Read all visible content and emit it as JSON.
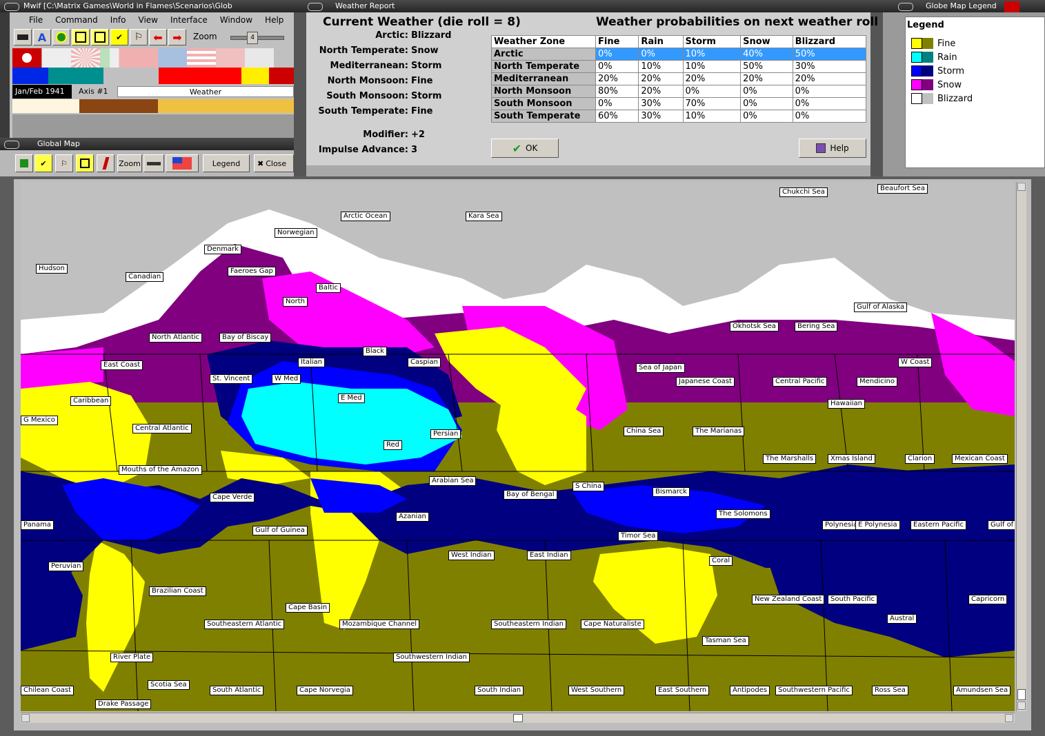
{
  "main_window": {
    "title": "Mwif [C:\\Matrix Games\\World in Flames\\Scenarios\\Glob",
    "menu": [
      "File",
      "Command",
      "Info",
      "View",
      "Interface",
      "Window",
      "Help"
    ],
    "zoom_label": "Zoom",
    "zoom_value": "4",
    "date": "Jan/Feb 1941",
    "phase": "Axis #1",
    "step": "Weather"
  },
  "global_map_window": {
    "title": "Global Map",
    "zoom_button": "Zoom",
    "legend_button": "Legend",
    "close_button": "Close"
  },
  "weather_report": {
    "title": "Weather Report",
    "current_heading": "Current Weather (die roll = 8)",
    "prob_heading": "Weather probabilities on next weather roll",
    "current": [
      {
        "zone": "Arctic:",
        "weather": "Blizzard"
      },
      {
        "zone": "North Temperate:",
        "weather": "Snow"
      },
      {
        "zone": "Mediterranean:",
        "weather": "Storm"
      },
      {
        "zone": "North Monsoon:",
        "weather": "Fine"
      },
      {
        "zone": "South Monsoon:",
        "weather": "Storm"
      },
      {
        "zone": "South Temperate:",
        "weather": "Fine"
      }
    ],
    "modifier_label": "Modifier:",
    "modifier_value": "+2",
    "impulse_label": "Impulse Advance:",
    "impulse_value": "3",
    "table_headers": [
      "Weather Zone",
      "Fine",
      "Rain",
      "Storm",
      "Snow",
      "Blizzard"
    ],
    "table_rows": [
      [
        "Arctic",
        "0%",
        "0%",
        "10%",
        "40%",
        "50%"
      ],
      [
        "North Temperate",
        "0%",
        "10%",
        "10%",
        "50%",
        "30%"
      ],
      [
        "Mediterranean",
        "20%",
        "20%",
        "20%",
        "20%",
        "20%"
      ],
      [
        "North Monsoon",
        "80%",
        "20%",
        "0%",
        "0%",
        "0%"
      ],
      [
        "South Monsoon",
        "0%",
        "30%",
        "70%",
        "0%",
        "0%"
      ],
      [
        "South Temperate",
        "60%",
        "30%",
        "10%",
        "0%",
        "0%"
      ]
    ],
    "ok_label": "OK",
    "help_label": "Help"
  },
  "legend_window": {
    "title": "Globe Map Legend",
    "heading": "Legend",
    "items": [
      {
        "label": "Fine",
        "c1": "#ffff00",
        "c2": "#808000"
      },
      {
        "label": "Rain",
        "c1": "#00ffff",
        "c2": "#008080"
      },
      {
        "label": "Storm",
        "c1": "#0000ff",
        "c2": "#000080"
      },
      {
        "label": "Snow",
        "c1": "#ff00ff",
        "c2": "#800080"
      },
      {
        "label": "Blizzard",
        "c1": "#ffffff",
        "c2": "#c0c0c0"
      }
    ]
  },
  "map_labels": [
    "Chukchi Sea",
    "Beaufort Sea",
    "Arctic Ocean",
    "Kara Sea",
    "Norwegian",
    "Denmark",
    "Hudson",
    "Canadian",
    "Faeroes Gap",
    "Baltic",
    "North",
    "Gulf of Alaska",
    "Okhotsk Sea",
    "Bering Sea",
    "North Atlantic",
    "Bay of Biscay",
    "Black",
    "East Coast",
    "Italian",
    "Caspian",
    "W Coast",
    "St. Vincent",
    "W Med",
    "Sea of Japan",
    "Japanese Coast",
    "Central Pacific",
    "Mendicino",
    "Caribbean",
    "E Med",
    "Hawaiian",
    "G Mexico",
    "Central Atlantic",
    "Persian",
    "China Sea",
    "The Marianas",
    "Red",
    "The Marshalls",
    "Xmas Island",
    "Clarion",
    "Mexican Coast",
    "Mouths of the Amazon",
    "Arabian Sea",
    "Cape Verde",
    "Bay of Bengal",
    "S China",
    "Bismarck",
    "Azanian",
    "The Solomons",
    "Panama",
    "Gulf of Guinea",
    "Polynesia",
    "E Polynesia",
    "Eastern Pacific",
    "Gulf of",
    "Timor Sea",
    "West Indian",
    "East Indian",
    "Coral",
    "Peruvian",
    "Brazilian Coast",
    "New Zealand Coast",
    "South Pacific",
    "Capricorn",
    "Cape Basin",
    "Austral",
    "Southeastern Atlantic",
    "Mozambique Channel",
    "Southeastern Indian",
    "Cape Naturaliste",
    "Tasman Sea",
    "River Plate",
    "Southwestern Indian",
    "Scotia Sea",
    "Chilean Coast",
    "South Atlantic",
    "Cape Norvegia",
    "South Indian",
    "West Southern",
    "East Southern",
    "Antipodes",
    "Southwestern Pacific",
    "Ross Sea",
    "Amundsen Sea",
    "Drake Passage"
  ]
}
